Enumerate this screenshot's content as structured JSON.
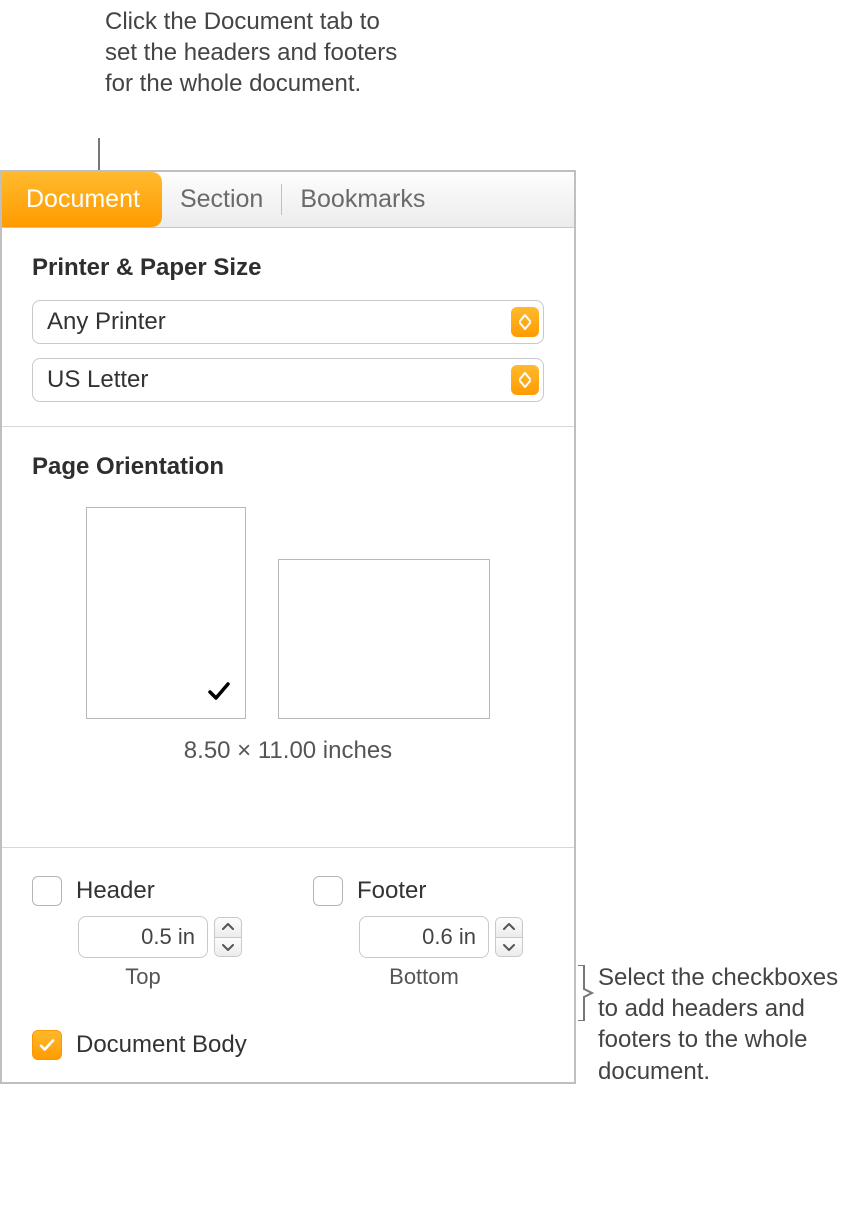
{
  "callouts": {
    "top": "Click the Document tab to set the headers and footers for the whole document.",
    "right": "Select the checkboxes to add headers and footers to the whole document."
  },
  "tabs": {
    "document": "Document",
    "section": "Section",
    "bookmarks": "Bookmarks"
  },
  "printer_section": {
    "title": "Printer & Paper Size",
    "printer_value": "Any Printer",
    "paper_value": "US Letter"
  },
  "orientation_section": {
    "title": "Page Orientation",
    "size_text": "8.50 × 11.00 inches"
  },
  "hf_section": {
    "header_label": "Header",
    "footer_label": "Footer",
    "header_value": "0.5 in",
    "footer_value": "0.6 in",
    "top_label": "Top",
    "bottom_label": "Bottom"
  },
  "docbody_label": "Document Body"
}
